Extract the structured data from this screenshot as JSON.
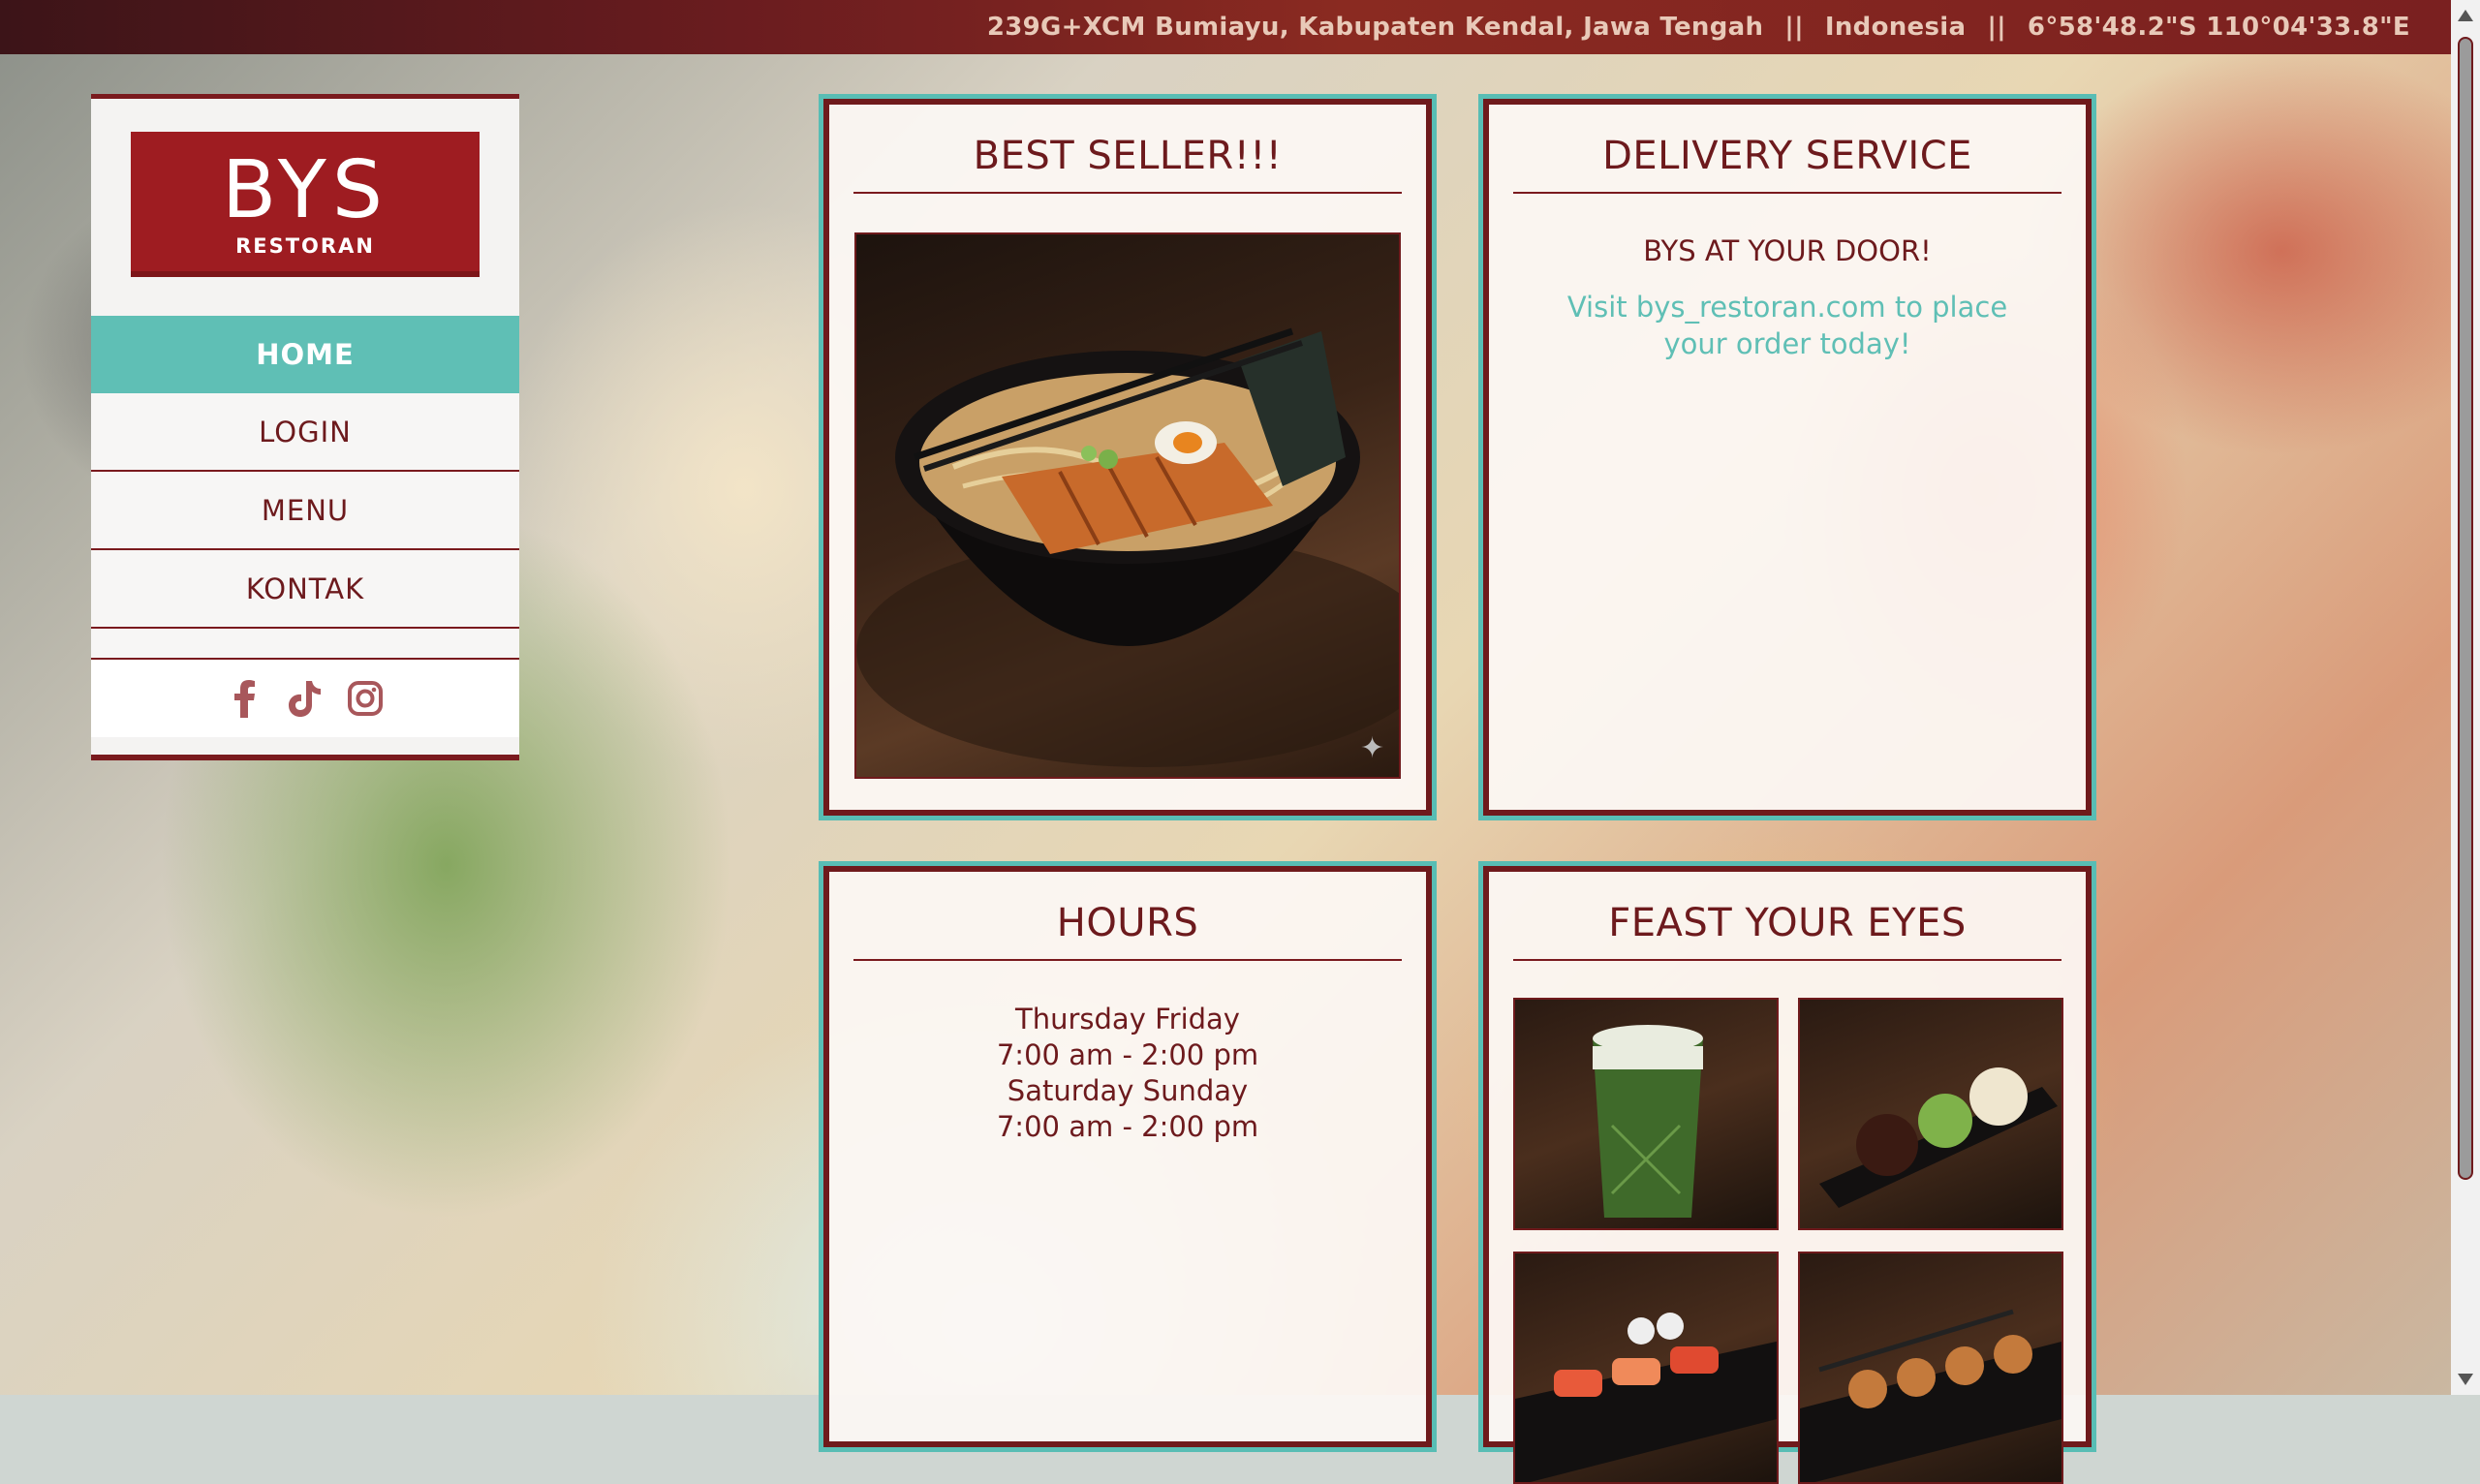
{
  "topbar": {
    "address": "239G+XCM Bumiayu, Kabupaten Kendal, Jawa Tengah",
    "separator": "||",
    "country": "Indonesia",
    "coordinates": "6°58'48.2\"S 110°04'33.8\"E"
  },
  "logo": {
    "brand": "BYS",
    "subtitle": "RESTORAN"
  },
  "nav": {
    "items": [
      {
        "label": "HOME"
      },
      {
        "label": "LOGIN"
      },
      {
        "label": "MENU"
      },
      {
        "label": "KONTAK"
      }
    ]
  },
  "socials": [
    "facebook-icon",
    "tiktok-icon",
    "instagram-icon"
  ],
  "best_seller": {
    "title": "BEST SELLER!!!"
  },
  "delivery": {
    "title": "DELIVERY SERVICE",
    "headline": "BYS AT YOUR DOOR!",
    "text": "Visit bys_restoran.com to place your order today!"
  },
  "hours": {
    "title": "HOURS",
    "lines": [
      "Thursday Friday",
      "7:00 am - 2:00 pm",
      "Saturday Sunday",
      "7:00 am - 2:00 pm"
    ]
  },
  "feast": {
    "title": "FEAST YOUR EYES"
  },
  "colors": {
    "brand": "#9e1c21",
    "maroon": "#6d1a1d",
    "teal": "#5fbfb5"
  }
}
